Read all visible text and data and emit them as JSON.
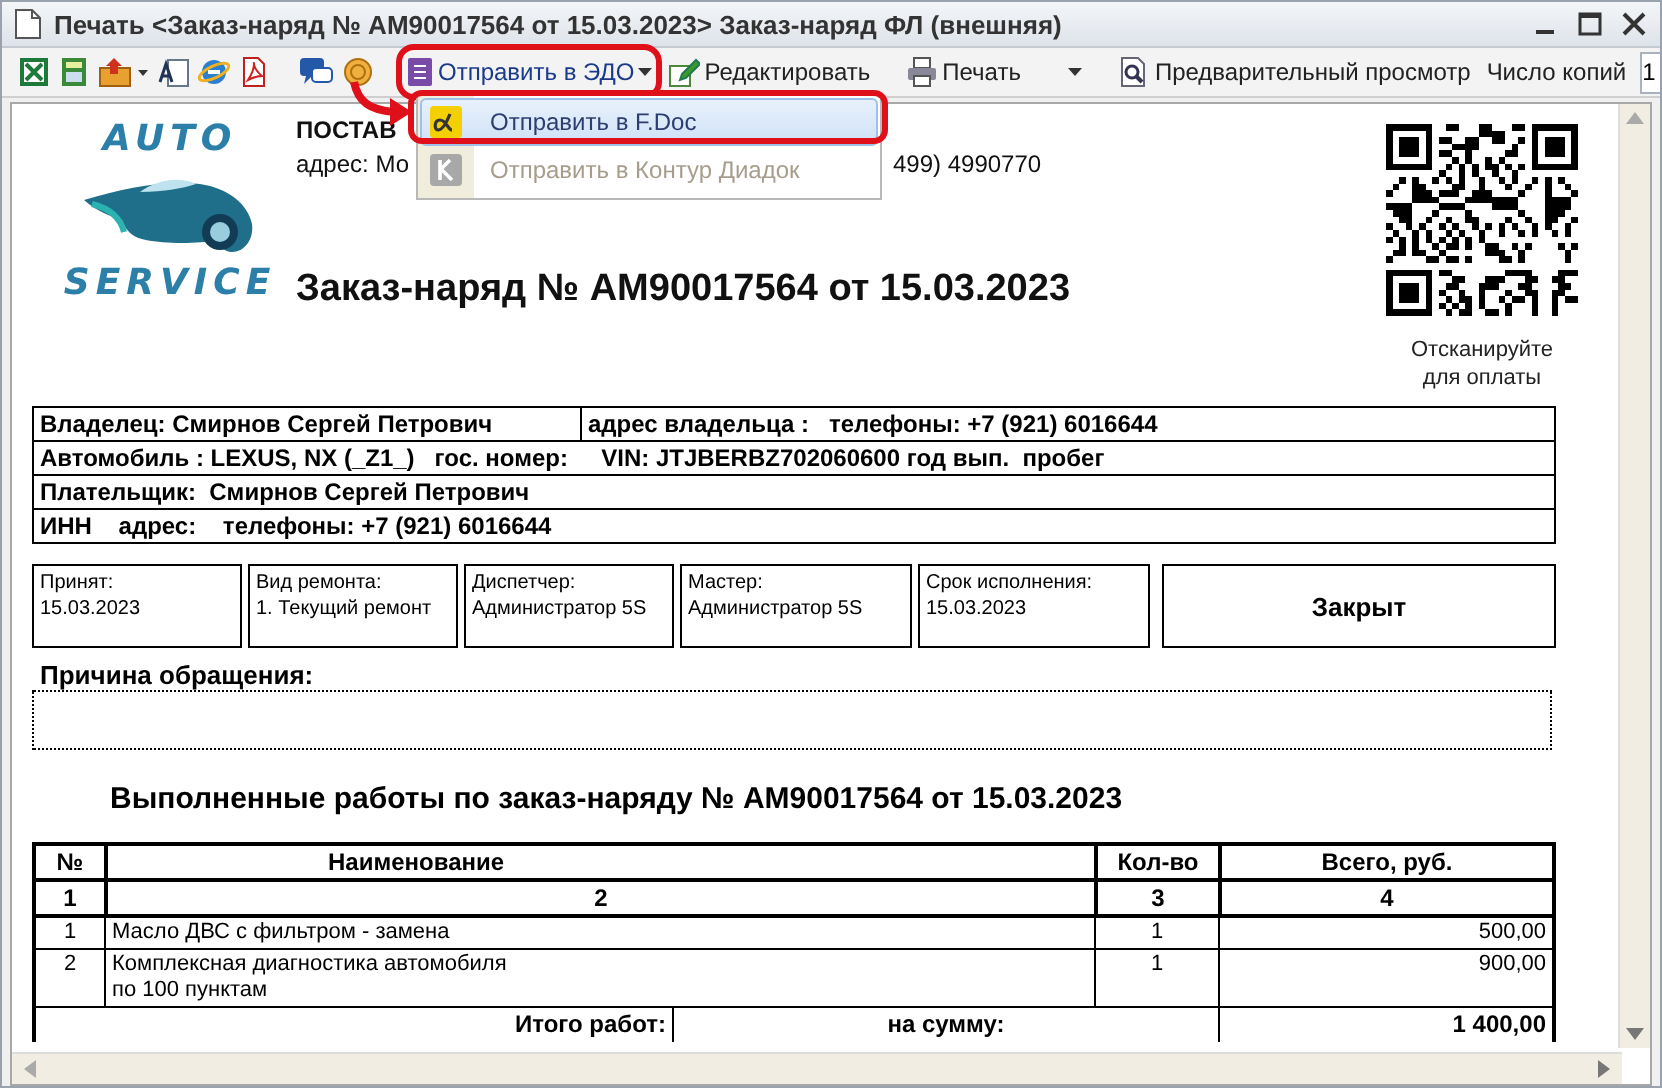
{
  "window": {
    "title": "Печать <Заказ-наряд № АМ90017564 от 15.03.2023> Заказ-наряд ФЛ (внешняя)"
  },
  "toolbar": {
    "send_button": "Отправить в ЭДО",
    "edit_button": "Редактировать",
    "print_button": "Печать",
    "preview_button": "Предварительный просмотр",
    "copies_label": "Число копий",
    "copies_value": "1"
  },
  "send_menu": {
    "items": [
      {
        "label": "Отправить в F.Doc",
        "selected": true,
        "disabled": false
      },
      {
        "label": "Отправить в Контур Диадок",
        "selected": false,
        "disabled": true
      }
    ]
  },
  "document": {
    "logo": {
      "top": "AUTO",
      "bottom": "SERVICE"
    },
    "supplier_label": "ПОСТАВ",
    "address_start": "адрес: Мо",
    "address_end": "499) 4990770",
    "title": "Заказ-наряд № АМ90017564 от 15.03.2023",
    "qr_caption": "Отсканируйте для оплаты",
    "info_rows": [
      [
        "Владелец: Смирнов Сергей Петрович",
        "адрес владельца :   телефоны: +7 (921) 6016644"
      ],
      [
        "Автомобиль : LEXUS, NX (_Z1_)   гос. номер:     VIN: JTJBERBZ702060600 год вып.  пробег"
      ],
      [
        "Плательщик:  Смирнов Сергей Петрович"
      ],
      [
        "ИНН    адрес:    телефоны: +7 (921) 6016644"
      ]
    ],
    "fields": [
      {
        "label": "Принят:",
        "value": "15.03.2023"
      },
      {
        "label": "Вид ремонта:",
        "value": "1. Текущий ремонт"
      },
      {
        "label": "Диспетчер:",
        "value": "Администратор 5S"
      },
      {
        "label": "Мастер:",
        "value": "Администратор 5S"
      },
      {
        "label": "Срок исполнения:",
        "value": "15.03.2023"
      }
    ],
    "status": "Закрыт",
    "reason_label": "Причина обращения:",
    "works_title": "Выполненные работы по заказ-наряду №  АМ90017564 от 15.03.2023",
    "table": {
      "columns": [
        "№",
        "Наименование",
        "Кол-во",
        "Всего, руб."
      ],
      "column_numbers": [
        "1",
        "2",
        "3",
        "4"
      ],
      "rows": [
        {
          "n": "1",
          "name": "Масло ДВС с фильтром - замена",
          "qty": "1",
          "total": "500,00"
        },
        {
          "n": "2",
          "name": "Комплексная диагностика автомобиля\nпо 100 пунктам",
          "qty": "1",
          "total": "900,00"
        }
      ],
      "totals": {
        "label": "Итого работ:",
        "sum_label": "на сумму:",
        "sum": "1 400,00"
      }
    }
  }
}
